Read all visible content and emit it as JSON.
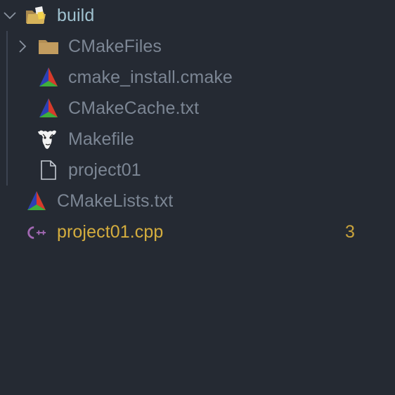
{
  "explorer": {
    "folder": {
      "label": "build",
      "label_color": "#9fc1cf",
      "expanded": true,
      "icon": "open-folder-icon",
      "children": [
        {
          "label": "CMakeFiles",
          "icon": "folder-icon",
          "collapsed": true
        },
        {
          "label": "cmake_install.cmake",
          "icon": "cmake-icon"
        },
        {
          "label": "CMakeCache.txt",
          "icon": "cmake-icon"
        },
        {
          "label": "Makefile",
          "icon": "gnu-icon"
        },
        {
          "label": "project01",
          "icon": "file-icon"
        }
      ]
    },
    "files": [
      {
        "label": "CMakeLists.txt",
        "icon": "cmake-icon"
      },
      {
        "label": "project01.cpp",
        "icon": "cpp-icon",
        "label_color": "#d4ad3e",
        "badge": "3",
        "badge_color": "#c9a33c"
      }
    ],
    "colors": {
      "background": "#252a33",
      "text": "#7c8694",
      "guide": "#3c4350",
      "cpp_icon": "#a268b3"
    }
  }
}
